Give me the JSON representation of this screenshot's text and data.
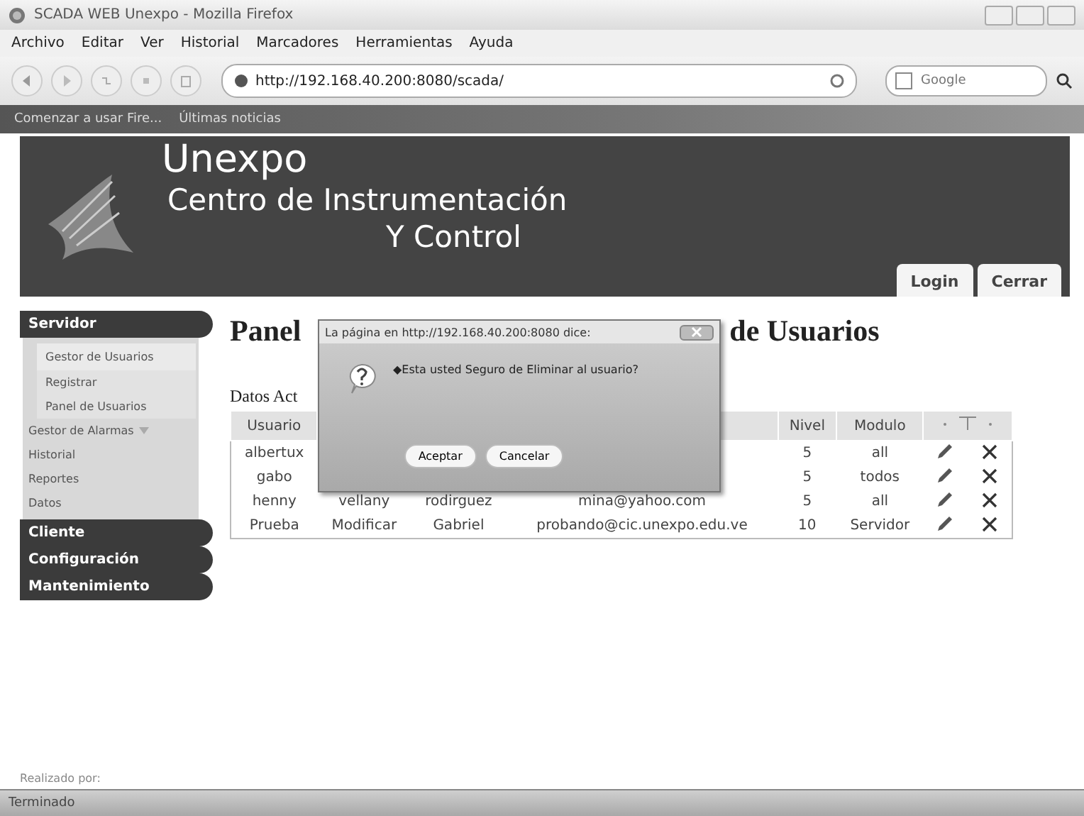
{
  "window": {
    "title": "SCADA WEB Unexpo - Mozilla Firefox"
  },
  "menu": [
    "Archivo",
    "Editar",
    "Ver",
    "Historial",
    "Marcadores",
    "Herramientas",
    "Ayuda"
  ],
  "toolbar": {
    "url": "http://192.168.40.200:8080/scada/",
    "search_placeholder": "Google"
  },
  "bookmarks": [
    "Comenzar a usar Fire...",
    "Últimas noticias"
  ],
  "banner": {
    "title": "Unexpo",
    "subtitle": "Centro de Instrumentación",
    "subtitle2": "Y Control",
    "tabs": [
      "Login",
      "Cerrar"
    ]
  },
  "sidebar": [
    {
      "label": "Servidor",
      "expanded": true,
      "items": [
        {
          "label": "Gestor de Usuarios",
          "kind": "group"
        },
        {
          "label": "Registrar",
          "kind": "sub"
        },
        {
          "label": "Panel de Usuarios",
          "kind": "sub"
        },
        {
          "label": "Gestor de Alarmas",
          "kind": "dropdown"
        },
        {
          "label": "Historial",
          "kind": "item"
        },
        {
          "label": "Reportes",
          "kind": "item"
        },
        {
          "label": "Datos",
          "kind": "item"
        }
      ]
    },
    {
      "label": "Cliente"
    },
    {
      "label": "Configuración"
    },
    {
      "label": "Mantenimiento"
    }
  ],
  "heading": {
    "left": "Panel",
    "right": "de Usuarios"
  },
  "subheading": "Datos Act",
  "table": {
    "columns": [
      "Usuario",
      null,
      null,
      null,
      "Nivel",
      "Modulo"
    ],
    "rows": [
      {
        "cells": [
          "albertux",
          null,
          null,
          null,
          "5",
          "all"
        ]
      },
      {
        "cells": [
          "gabo",
          null,
          null,
          null,
          "5",
          "todos"
        ]
      },
      {
        "cells": [
          "henny",
          "vellany",
          "rodirguez",
          "mina@yahoo.com",
          "5",
          "all"
        ]
      },
      {
        "cells": [
          "Prueba",
          "Modificar",
          "Gabriel",
          "probando@cic.unexpo.edu.ve",
          "10",
          "Servidor"
        ]
      }
    ]
  },
  "dialog": {
    "title": "La página en http://192.168.40.200:8080 dice:",
    "message": "◆Esta usted Seguro de Eliminar al usuario?",
    "buttons": [
      "Aceptar",
      "Cancelar"
    ]
  },
  "footer": "Realizado por:",
  "status_bar": "Terminado"
}
